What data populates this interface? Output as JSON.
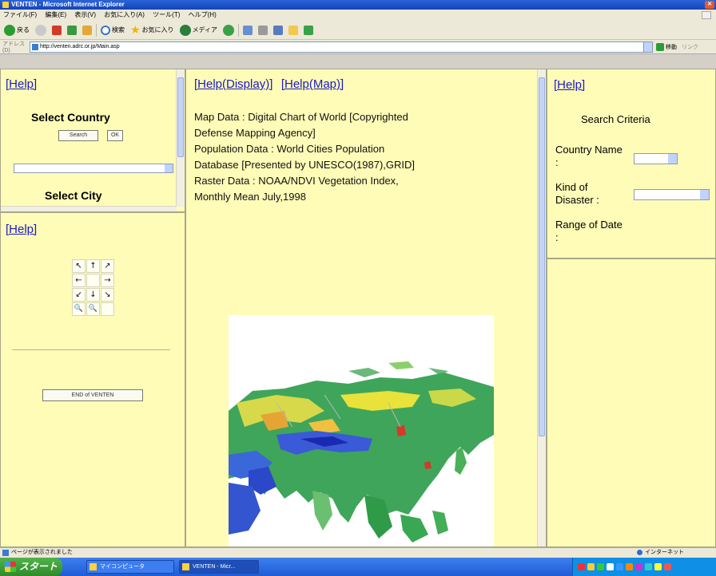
{
  "window": {
    "title": "VENTEN - Microsoft Internet Explorer",
    "menu": [
      "ファイル(F)",
      "編集(E)",
      "表示(V)",
      "お気に入り(A)",
      "ツール(T)",
      "ヘルプ(H)"
    ],
    "toolbar": {
      "back_label": "戻る",
      "search_label": "検索",
      "favorites_label": "お気に入り",
      "media_label": "メディア"
    },
    "address": {
      "label": "アドレス(D)",
      "url": "http://venten.adrc.or.jp/Main.asp",
      "go_label": "移動",
      "links_label": "リンク"
    }
  },
  "left_top": {
    "help": "[Help]",
    "select_country": "Select Country",
    "search_button": "Search",
    "ok_button": "OK",
    "select_city": "Select City"
  },
  "left_bottom": {
    "help": "[Help]",
    "nav": [
      "↖",
      "↑",
      "↗",
      "←",
      "",
      "→",
      "↙",
      "↓",
      "↘",
      "🔍",
      "🔍",
      ""
    ],
    "end_button": "END of VENTEN"
  },
  "center": {
    "help_display": "[Help(Display)]",
    "help_map": "[Help(Map)]",
    "info_lines": [
      "Map Data : Digital Chart of World [Copyrighted",
      "Defense Mapping Agency]",
      "Population Data : World Cities Population",
      "Database [Presented by UNESCO(1987),GRID]",
      "Raster Data : NOAA/NDVI Vegetation Index,",
      "Monthly Mean July,1998"
    ]
  },
  "right_top": {
    "help": "[Help]",
    "title": "Search Criteria",
    "country_name_label": "Country Name :",
    "kind_label": "Kind of Disaster :",
    "range_label": "Range of Date :"
  },
  "status": {
    "message": "ページが表示されました",
    "zone": "インターネット"
  },
  "taskbar": {
    "start": "スタート",
    "tasks": [
      "マイコンピュータ",
      "VENTEN - Micr..."
    ]
  }
}
